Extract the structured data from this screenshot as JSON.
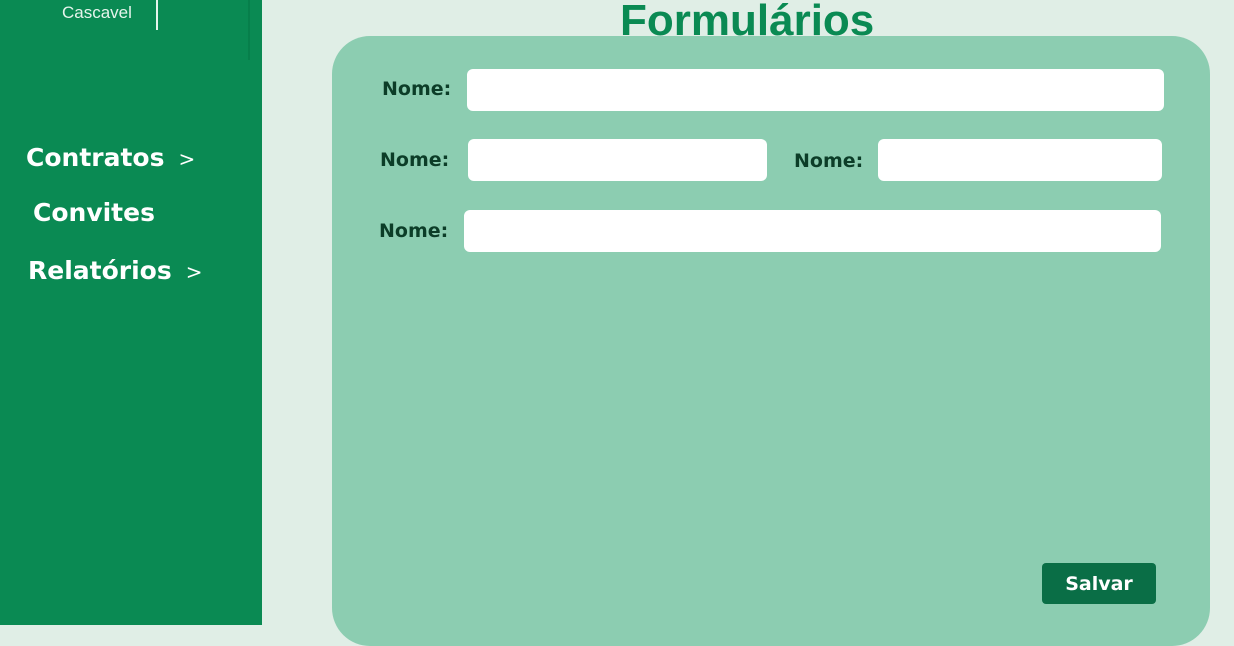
{
  "brand": {
    "city": "Cascavel"
  },
  "page": {
    "title": "Formulários"
  },
  "sidebar": {
    "items": [
      {
        "label": "Contratos",
        "chevron": ">"
      },
      {
        "label": "Convites"
      },
      {
        "label": "Relatórios",
        "chevron": ">"
      }
    ]
  },
  "form": {
    "fields": [
      {
        "label": "Nome:",
        "value": "",
        "placeholder": ""
      },
      {
        "label": "Nome:",
        "value": "",
        "placeholder": ""
      },
      {
        "label": "Nome:",
        "value": "",
        "placeholder": ""
      },
      {
        "label": "Nome:",
        "value": "",
        "placeholder": ""
      }
    ],
    "save_label": "Salvar"
  },
  "colors": {
    "sidebar": "#0a8a53",
    "background": "#e0eee6",
    "panel": "#8ccdb1",
    "save_button": "#0a6e46",
    "label_text": "#0c3d28"
  }
}
